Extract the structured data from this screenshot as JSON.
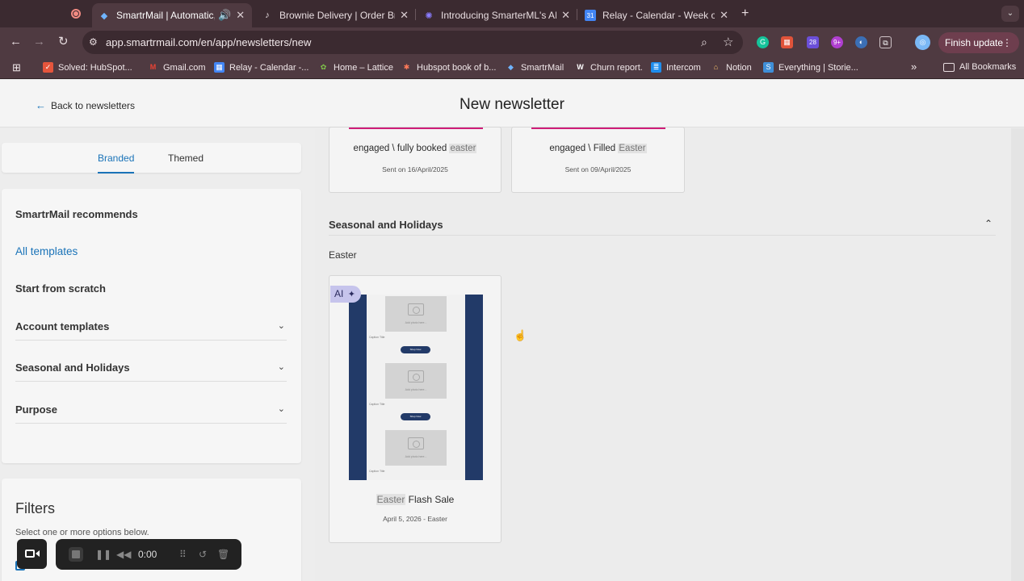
{
  "browser": {
    "tabs": [
      {
        "title": "SmartrMail | Automatic, pe",
        "active": true
      },
      {
        "title": "Brownie Delivery | Order Brow"
      },
      {
        "title": "Introducing SmarterML's AI N"
      },
      {
        "title": "Relay - Calendar - Week of M"
      }
    ],
    "new_tab": "+",
    "url": "app.smartrmail.com/en/app/newsletters/new",
    "finish_update": "Finish update",
    "extension_badges": {
      "cal": "28",
      "ext": "9+"
    },
    "bookmarks": [
      "Solved: HubSpot...",
      "Gmail.com",
      "Relay - Calendar -...",
      "Home – Lattice",
      "Hubspot book of b...",
      "SmartrMail",
      "Churn report.",
      "Intercom",
      "Notion",
      "Everything | Storie..."
    ],
    "all_bookmarks": "All Bookmarks"
  },
  "header": {
    "back_label": "Back to newsletters",
    "title": "New newsletter"
  },
  "sidebar": {
    "tabs": [
      "Branded",
      "Themed"
    ],
    "nav": {
      "recommends": "SmartrMail recommends",
      "all_templates": "All templates",
      "scratch": "Start from scratch",
      "account": "Account templates",
      "seasonal": "Seasonal and Holidays",
      "purpose": "Purpose"
    },
    "filters": {
      "title": "Filters",
      "subtitle": "Select one or more options below."
    }
  },
  "main": {
    "top_cards": [
      {
        "name_pre": "engaged \\ fully booked ",
        "name_hl": "easter",
        "date": "Sent on 16/April/2025"
      },
      {
        "name_pre": "engaged \\ Filled ",
        "name_hl": "Easter",
        "date": "Sent on 09/April/2025"
      }
    ],
    "section": {
      "title": "Seasonal and Holidays",
      "subsection": "Easter"
    },
    "template": {
      "badge": "AI",
      "name_hl": "Easter",
      "name_post": " Flash Sale",
      "date": "April 5, 2026 - Easter",
      "preview": {
        "photo_text": "Add photo here...",
        "caption": "Caption Title",
        "button": "Shop Now"
      }
    }
  },
  "recorder": {
    "time": "0:00"
  },
  "colors": {
    "accent": "#1a73b8",
    "brand_pink": "#cf1d78",
    "navy": "#223a68"
  }
}
